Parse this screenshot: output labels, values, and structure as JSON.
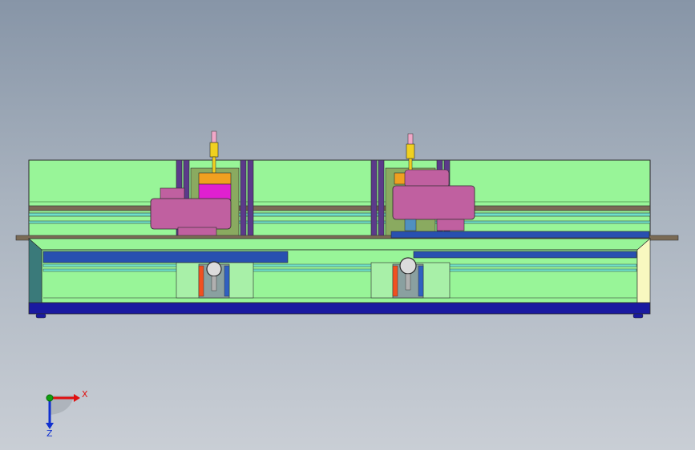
{
  "viewport": {
    "background_top": "#8795a7",
    "background_bottom": "#c9ced5"
  },
  "triad": {
    "x_label": "X",
    "z_label": "Z",
    "x_color": "#e01010",
    "y_color": "#10a010",
    "z_color": "#1030d0"
  },
  "model": {
    "colors": {
      "panel_green": "#98f598",
      "frame_edge": "#2a2a2a",
      "rail_teal": "#6fe0c8",
      "rod_brown": "#7a6a55",
      "base_blue": "#1a1aa0",
      "plate_blue": "#2850b0",
      "post_purple": "#5b3a8a",
      "bracket_olive": "#8aaa60",
      "block_orange": "#f0a020",
      "block_magenta": "#e020d0",
      "motor_pink": "#c060a0",
      "shaft_yellow": "#f0d020",
      "tip_pink": "#f0a8c8",
      "side_cream": "#f8f8c0",
      "side_teal": "#3a7a7a"
    }
  }
}
